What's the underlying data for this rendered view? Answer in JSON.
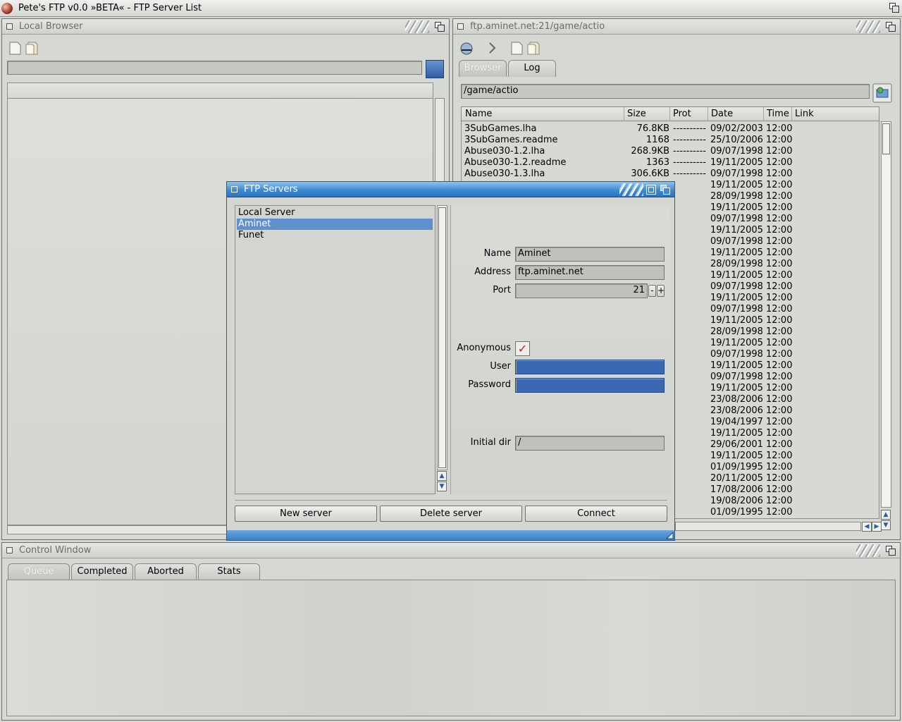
{
  "screen": {
    "title": "Pete's FTP v0.0 »BETA« - FTP Server List"
  },
  "local_browser": {
    "title": "Local Browser"
  },
  "remote_browser": {
    "title": "ftp.aminet.net:21/game/actio",
    "tabs": [
      {
        "label": "Browser",
        "active": true
      },
      {
        "label": "Log",
        "active": false
      }
    ],
    "path": "/game/actio",
    "columns": [
      "Name",
      "Size",
      "Prot",
      "Date",
      "Time",
      "Link"
    ],
    "files": [
      {
        "name": "3SubGames.lha",
        "size": "76.8KB",
        "prot": "----------",
        "date": "09/02/2003",
        "time": "12:00"
      },
      {
        "name": "3SubGames.readme",
        "size": "1168",
        "prot": "----------",
        "date": "25/10/2006",
        "time": "12:00"
      },
      {
        "name": "Abuse030-1.2.lha",
        "size": "268.9KB",
        "prot": "----------",
        "date": "09/07/1998",
        "time": "12:00"
      },
      {
        "name": "Abuse030-1.2.readme",
        "size": "1363",
        "prot": "----------",
        "date": "19/11/2005",
        "time": "12:00"
      },
      {
        "name": "Abuse030-1.3.lha",
        "size": "306.6KB",
        "prot": "----------",
        "date": "09/07/1998",
        "time": "12:00"
      },
      {
        "date": "19/11/2005",
        "time": "12:00"
      },
      {
        "date": "28/09/1998",
        "time": "12:00"
      },
      {
        "date": "19/11/2005",
        "time": "12:00"
      },
      {
        "date": "09/07/1998",
        "time": "12:00"
      },
      {
        "date": "19/11/2005",
        "time": "12:00"
      },
      {
        "date": "09/07/1998",
        "time": "12:00"
      },
      {
        "date": "19/11/2005",
        "time": "12:00"
      },
      {
        "date": "28/09/1998",
        "time": "12:00"
      },
      {
        "date": "19/11/2005",
        "time": "12:00"
      },
      {
        "date": "09/07/1998",
        "time": "12:00"
      },
      {
        "date": "19/11/2005",
        "time": "12:00"
      },
      {
        "date": "09/07/1998",
        "time": "12:00"
      },
      {
        "date": "19/11/2005",
        "time": "12:00"
      },
      {
        "date": "28/09/1998",
        "time": "12:00"
      },
      {
        "date": "19/11/2005",
        "time": "12:00"
      },
      {
        "date": "09/07/1998",
        "time": "12:00"
      },
      {
        "date": "19/11/2005",
        "time": "12:00"
      },
      {
        "date": "09/07/1998",
        "time": "12:00"
      },
      {
        "date": "19/11/2005",
        "time": "12:00"
      },
      {
        "date": "23/08/2006",
        "time": "12:00"
      },
      {
        "date": "23/08/2006",
        "time": "12:00"
      },
      {
        "date": "19/04/1997",
        "time": "12:00"
      },
      {
        "date": "19/11/2005",
        "time": "12:00"
      },
      {
        "date": "29/06/2001",
        "time": "12:00"
      },
      {
        "date": "19/11/2005",
        "time": "12:00"
      },
      {
        "date": "01/09/1995",
        "time": "12:00"
      },
      {
        "date": "20/11/2005",
        "time": "12:00"
      },
      {
        "date": "17/08/2006",
        "time": "12:00"
      },
      {
        "date": "19/08/2006",
        "time": "12:00"
      },
      {
        "date": "01/09/1995",
        "time": "12:00"
      }
    ]
  },
  "dialog": {
    "title": "FTP Servers",
    "servers": [
      {
        "label": "Local Server",
        "selected": false
      },
      {
        "label": "Aminet",
        "selected": true
      },
      {
        "label": "Funet",
        "selected": false
      }
    ],
    "name_label": "Name",
    "name_value": "Aminet",
    "address_label": "Address",
    "address_value": "ftp.aminet.net",
    "port_label": "Port",
    "port_value": "21",
    "port_minus": "-",
    "port_plus": "+",
    "anonymous_label": "Anonymous",
    "anonymous_checked": true,
    "check_mark": "✓",
    "user_label": "User",
    "user_value": "",
    "password_label": "Password",
    "password_value": "",
    "initdir_label": "Initial dir",
    "initdir_value": "/",
    "buttons": {
      "new": "New server",
      "delete": "Delete server",
      "connect": "Connect"
    }
  },
  "control_window": {
    "title": "Control Window",
    "tabs": [
      {
        "label": "Queue",
        "active": true
      },
      {
        "label": "Completed",
        "active": false
      },
      {
        "label": "Aborted",
        "active": false
      },
      {
        "label": "Stats",
        "active": false
      }
    ]
  },
  "colors": {
    "selection": "#5f8fcc",
    "dialog_title": "#3f8ad3",
    "check": "#d01818",
    "input_blue": "#3a68b4"
  }
}
